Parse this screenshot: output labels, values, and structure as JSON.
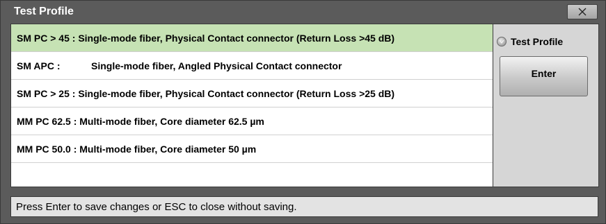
{
  "dialog": {
    "title": "Test Profile",
    "close_icon": "close-x-icon"
  },
  "profiles": [
    {
      "code": "SM PC > 45",
      "separator": " : ",
      "description": "Single-mode fiber, Physical Contact connector (Return Loss >45 dB)",
      "selected": true
    },
    {
      "code": "SM APC :",
      "separator": "",
      "description": "Single-mode fiber, Angled Physical Contact connector",
      "selected": false
    },
    {
      "code": "SM PC > 25",
      "separator": " : ",
      "description": "Single-mode fiber, Physical Contact connector (Return Loss >25 dB)",
      "selected": false
    },
    {
      "code": "MM PC 62.5",
      "separator": " : ",
      "description": "Multi-mode fiber, Core diameter 62.5 µm",
      "selected": false
    },
    {
      "code": "MM PC 50.0",
      "separator": " : ",
      "description": "Multi-mode fiber, Core diameter 50 µm",
      "selected": false
    }
  ],
  "side": {
    "radio_label": "Test Profile",
    "radio_icon": "radio-check-icon",
    "enter_label": "Enter"
  },
  "status": {
    "message": "Press Enter to save changes or ESC to close without saving."
  },
  "colors": {
    "selected_row": "#c6e2b4",
    "frame": "#5b5b5b",
    "side_panel": "#d6d6d6"
  }
}
